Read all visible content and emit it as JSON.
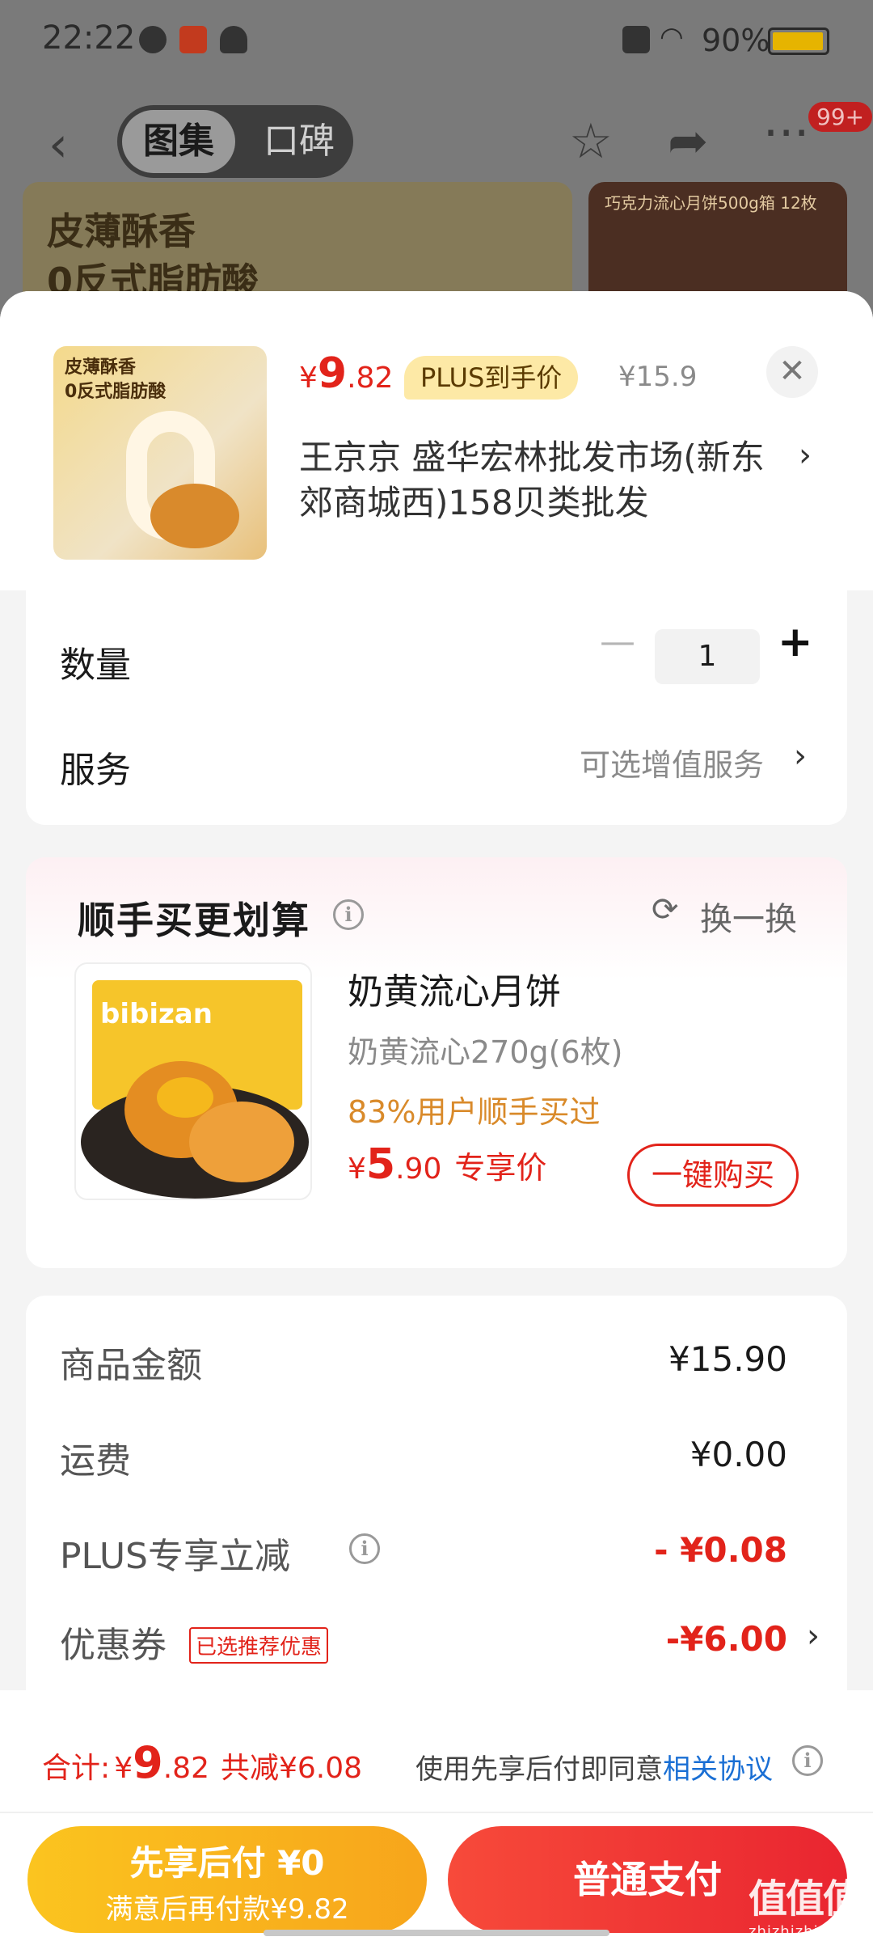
{
  "status_bar": {
    "time": "22:22",
    "battery": "90%"
  },
  "nav": {
    "tab_gallery": "图集",
    "tab_reviews": "口碑",
    "badge": "99+"
  },
  "banner": {
    "text": "皮薄酥香\n0反式脂肪酸",
    "side_text": "巧克力流心月饼500g箱   12枚"
  },
  "product": {
    "thumb_text": "皮薄酥香\n0反式脂肪酸",
    "price_symbol": "¥",
    "price_big": "9",
    "price_small": ".82",
    "plus_tag": "PLUS到手价",
    "original_price": "¥15.9",
    "address": "王京京  盛华宏林批发市场(新东郊商城西)158贝类批发"
  },
  "quantity": {
    "label": "数量",
    "value": "1"
  },
  "service": {
    "label": "服务",
    "value": "可选增值服务"
  },
  "bundle": {
    "title": "顺手买更划算",
    "refresh": "换一换",
    "brand": "bibizan",
    "name": "奶黄流心月饼",
    "spec": "奶黄流心270g(6枚)",
    "percent": "83%用户顺手买过",
    "price_symbol": "¥",
    "price_big": "5",
    "price_small": ".90",
    "price_tag": "专享价",
    "buy_label": "一键购买"
  },
  "summary": {
    "rows": [
      {
        "label": "商品金额",
        "value": "¥15.90"
      },
      {
        "label": "运费",
        "value": "¥0.00"
      },
      {
        "label": "PLUS专享立减",
        "value": "- ¥0.08"
      },
      {
        "label": "优惠券",
        "value": "-¥6.00",
        "tag": "已选推荐优惠"
      }
    ]
  },
  "footer": {
    "total_label": "合计:",
    "total_symbol": "¥",
    "total_big": "9",
    "total_small": ".82",
    "saved": "共减¥6.08",
    "agree_text": "使用先享后付即同意",
    "agree_link": "相关协议",
    "later_line1": "先享后付 ¥0",
    "later_line2": "满意后再付款¥9.82",
    "pay_label": "普通支付"
  },
  "watermark": {
    "text": "值值值",
    "sub": "zhizhizhi.com"
  },
  "colors": {
    "accent_red": "#e2231a",
    "gold": "#f7a51b",
    "link_blue": "#1a6fd4"
  }
}
